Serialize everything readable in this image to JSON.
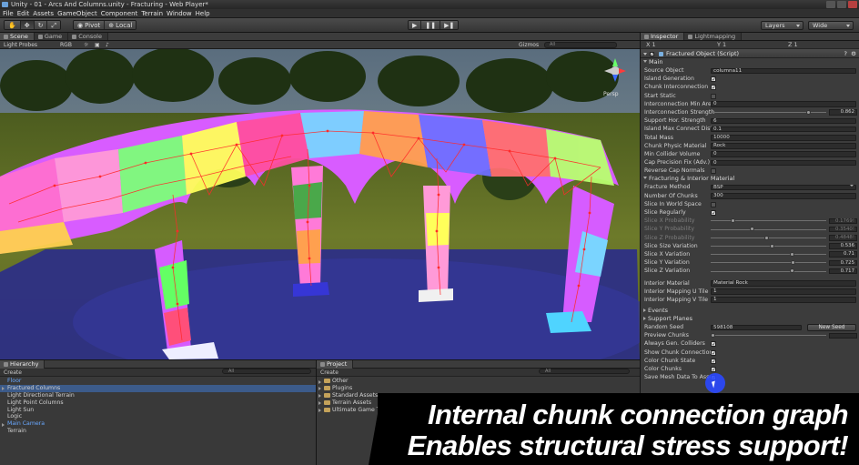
{
  "window": {
    "title": "Unity - 01 - Arcs And Columns.unity - Fracturing - Web Player*"
  },
  "menu": [
    "File",
    "Edit",
    "Assets",
    "GameObject",
    "Component",
    "Terrain",
    "Window",
    "Help"
  ],
  "toolbar": {
    "pivot": "Pivot",
    "local": "Local",
    "layers": "Layers",
    "layout": "Wide"
  },
  "scene": {
    "tabs": [
      "Scene",
      "Game",
      "Console"
    ],
    "render_mode": "Light Probes",
    "color_mode": "RGB",
    "gizmos": "Gizmos",
    "search": "All",
    "persp": "Persp"
  },
  "inspector": {
    "tabs": [
      "Inspector",
      "Lightmapping"
    ],
    "xyz": {
      "x": "X  1",
      "y": "Y  1",
      "z": "Z  1"
    },
    "component_title": "Fractured Object (Script)",
    "section_main": "Main",
    "rows_main": [
      {
        "label": "Source Object",
        "kind": "field",
        "value": "columna11"
      },
      {
        "label": "Island Generation",
        "kind": "check",
        "checked": true
      },
      {
        "label": "Chunk Interconnection",
        "kind": "check",
        "checked": true
      },
      {
        "label": "Start Static",
        "kind": "check",
        "checked": false
      },
      {
        "label": "Interconnection Min Area",
        "kind": "field",
        "value": "0"
      },
      {
        "label": "Interconnection Strength",
        "kind": "slider",
        "value": "0.862",
        "pos": 0.862
      },
      {
        "label": "Support Hor. Strength",
        "kind": "field",
        "value": "6"
      },
      {
        "label": "Island Max Connect Dist.",
        "kind": "field",
        "value": "0.1"
      },
      {
        "label": "Total Mass",
        "kind": "field",
        "value": "10000"
      },
      {
        "label": "Chunk Physic Material",
        "kind": "field",
        "value": "Rock"
      },
      {
        "label": "Min Collider Volume",
        "kind": "field",
        "value": "0"
      },
      {
        "label": "Cap Precision Fix (Adv.)",
        "kind": "field",
        "value": "0"
      },
      {
        "label": "Reverse Cap Normals",
        "kind": "check",
        "checked": false
      }
    ],
    "section_fracturing": "Fracturing & Interior Material",
    "rows_fracturing": [
      {
        "label": "Fracture Method",
        "kind": "dropdown",
        "value": "BSP"
      },
      {
        "label": "Number Of Chunks",
        "kind": "field",
        "value": "300"
      },
      {
        "label": "Slice In World Space",
        "kind": "check",
        "checked": false
      },
      {
        "label": "Slice Regularly",
        "kind": "check",
        "checked": true
      },
      {
        "label": "Slice X Probability",
        "kind": "slider",
        "value": "0.1769!",
        "pos": 0.18,
        "dim": true
      },
      {
        "label": "Slice Y Probability",
        "kind": "slider",
        "value": "0.3540!",
        "pos": 0.35,
        "dim": true
      },
      {
        "label": "Slice Z Probability",
        "kind": "slider",
        "value": "0.4848!",
        "pos": 0.48,
        "dim": true
      },
      {
        "label": "Slice Size Variation",
        "kind": "slider",
        "value": "0.536",
        "pos": 0.536
      },
      {
        "label": "Slice X Variation",
        "kind": "slider",
        "value": "0.71",
        "pos": 0.71
      },
      {
        "label": "Slice Y Variation",
        "kind": "slider",
        "value": "0.725",
        "pos": 0.725
      },
      {
        "label": "Slice Z Variation",
        "kind": "slider",
        "value": "0.717",
        "pos": 0.717
      }
    ],
    "rows_interior": [
      {
        "label": "Interior Material",
        "kind": "field",
        "value": "Material Rock"
      },
      {
        "label": "Interior Mapping U Tile",
        "kind": "field",
        "value": "1"
      },
      {
        "label": "Interior Mapping V Tile",
        "kind": "field",
        "value": "1"
      }
    ],
    "section_events": "Events",
    "section_support": "Support Planes",
    "rows_bottom": [
      {
        "label": "Random Seed",
        "kind": "seed",
        "value": "598108",
        "button": "New Seed"
      },
      {
        "label": "Preview Chunks",
        "kind": "slider",
        "value": "",
        "pos": 0.0
      },
      {
        "label": "Always Gen. Colliders",
        "kind": "check",
        "checked": true
      },
      {
        "label": "Show Chunk Connections",
        "kind": "check",
        "checked": true
      },
      {
        "label": "Color Chunk State",
        "kind": "check",
        "checked": true
      },
      {
        "label": "Color Chunks",
        "kind": "check",
        "checked": true
      },
      {
        "label": "Save Mesh Data To Asset",
        "kind": "check",
        "checked": true
      }
    ]
  },
  "hierarchy": {
    "tab": "Hierarchy",
    "create": "Create",
    "search": "All",
    "items": [
      {
        "label": "Floor",
        "color": "blue",
        "expandable": false
      },
      {
        "label": "Fractured Columns",
        "color": "white",
        "expandable": true,
        "selected": true
      },
      {
        "label": "Light Directional Terrain",
        "color": "white",
        "expandable": false
      },
      {
        "label": "Light Point Columns",
        "color": "white",
        "expandable": false
      },
      {
        "label": "Light Sun",
        "color": "white",
        "expandable": false
      },
      {
        "label": "Logic",
        "color": "white",
        "expandable": false
      },
      {
        "label": "Main Camera",
        "color": "blue",
        "expandable": true
      },
      {
        "label": "Terrain",
        "color": "white",
        "expandable": false
      }
    ]
  },
  "project": {
    "tab": "Project",
    "create": "Create",
    "search": "All",
    "items": [
      "Other",
      "Plugins",
      "Standard Assets",
      "Terrain Assets",
      "Ultimate Game Tools"
    ]
  },
  "banner": {
    "line1": "Internal chunk connection graph",
    "line2": "Enables structural stress support!"
  }
}
